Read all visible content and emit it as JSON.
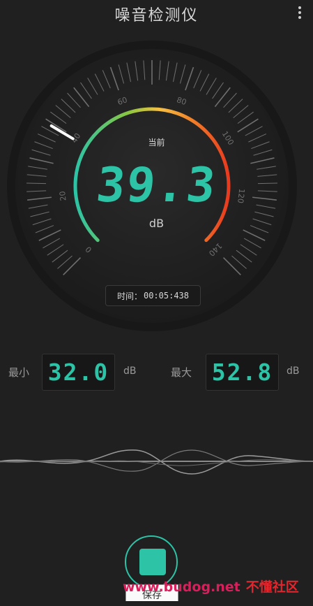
{
  "app": {
    "title": "噪音检测仪"
  },
  "icons": {
    "menu": "more-vertical-icon",
    "stop": "stop-square-icon"
  },
  "colors": {
    "accent": "#2cc3a6",
    "gauge_gradient": [
      "#2cc3a6",
      "#8cc63f",
      "#f6c044",
      "#f2842a",
      "#e83a1f"
    ],
    "background": "#202020"
  },
  "gauge": {
    "current_label": "当前",
    "value": "39.3",
    "unit": "dB",
    "scale_labels": [
      "0",
      "20",
      "40",
      "60",
      "80",
      "100",
      "120",
      "140"
    ],
    "scale_min": 0,
    "scale_max": 140,
    "needle_value": 39.3
  },
  "timer": {
    "label": "时间：",
    "value": "00:05:438"
  },
  "stats": {
    "min": {
      "label": "最小",
      "value": "32.0",
      "unit": "dB"
    },
    "max": {
      "label": "最大",
      "value": "52.8",
      "unit": "dB"
    }
  },
  "controls": {
    "save_label": "保存"
  },
  "watermark": {
    "url": "www.budog.net",
    "name": "不懂社区"
  }
}
